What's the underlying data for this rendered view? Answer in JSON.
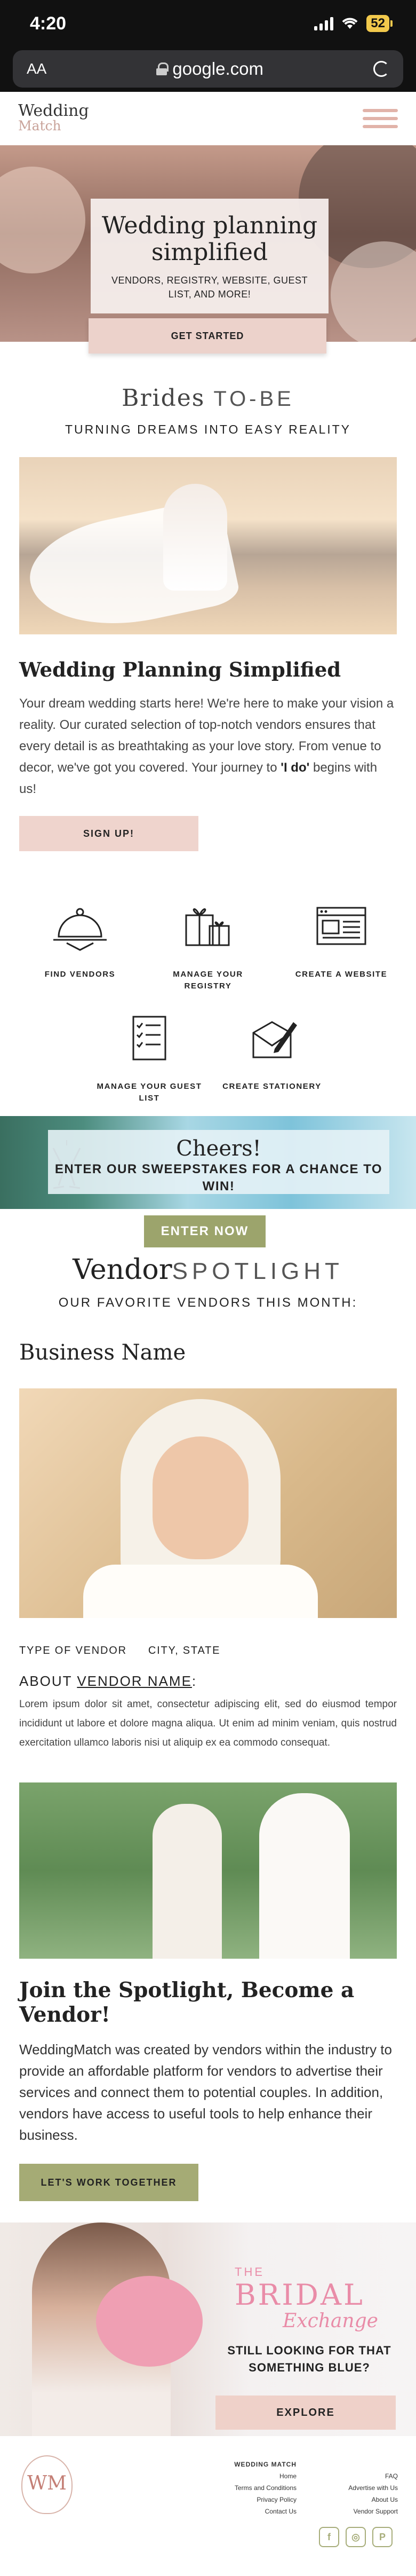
{
  "status_bar": {
    "time": "4:20",
    "battery": "52"
  },
  "browser": {
    "aa_label": "AA",
    "url": "google.com"
  },
  "header": {
    "logo_line1": "Wedding",
    "logo_line2": "Match"
  },
  "hero": {
    "title": "Wedding planning simplified",
    "subtitle": "VENDORS, REGISTRY, WEBSITE, GUEST LIST, AND MORE!",
    "cta": "GET STARTED"
  },
  "brides": {
    "title_script": "Brides",
    "title_caps": "TO-BE",
    "subtitle": "TURNING DREAMS INTO EASY REALITY"
  },
  "planning": {
    "heading": "Wedding Planning Simplified",
    "paragraph": "Your dream wedding starts here!  We're here to make your vision a reality. Our curated selection of top-notch vendors ensures that every detail is as breathtaking as your love story. From venue to decor, we've got you covered. Your journey to ",
    "emphasis": "'I do'",
    "paragraph_end": " begins with us!",
    "cta": "SIGN UP!"
  },
  "features": [
    {
      "icon": "cloche-icon",
      "label": "FIND VENDORS"
    },
    {
      "icon": "gift-icon",
      "label": "MANAGE YOUR REGISTRY"
    },
    {
      "icon": "browser-window-icon",
      "label": "CREATE A WEBSITE"
    },
    {
      "icon": "checklist-icon",
      "label": "MANAGE YOUR GUEST LIST"
    },
    {
      "icon": "envelope-pen-icon",
      "label": "CREATE STATIONERY"
    }
  ],
  "sweepstakes": {
    "title": "Cheers!",
    "subtitle": "ENTER OUR SWEEPSTAKES FOR A CHANCE TO WIN!",
    "cta": "ENTER NOW"
  },
  "spotlight": {
    "title_script": "Vendor",
    "title_caps": "SPOTLIGHT",
    "subtitle": "OUR FAVORITE VENDORS THIS MONTH:",
    "business_name": "Business Name",
    "type": "TYPE OF VENDOR",
    "location": "CITY, STATE",
    "about_prefix": "ABOUT ",
    "about_name": "VENDOR NAME",
    "about_suffix": ":",
    "description": "Lorem ipsum dolor sit amet, consectetur adipiscing elit, sed do eiusmod tempor incididunt ut labore et dolore magna aliqua. Ut enim ad minim veniam, quis nostrud exercitation ullamco laboris nisi ut aliquip ex ea commodo consequat."
  },
  "join": {
    "heading": "Join the Spotlight, Become a Vendor!",
    "paragraph": "WeddingMatch was created by vendors within the industry to provide an affordable platform for vendors to advertise their services and connect them to potential couples. In addition, vendors have access to useful tools to help enhance their business.",
    "cta": "LET'S WORK TOGETHER"
  },
  "bridal_exchange": {
    "the": "THE",
    "bridal": "BRIDAL",
    "exchange": "Exchange",
    "question": "STILL LOOKING FOR THAT SOMETHING BLUE?",
    "cta": "EXPLORE"
  },
  "footer": {
    "logo_monogram": "WM",
    "col1": {
      "heading": "WEDDING MATCH",
      "links": [
        "Home",
        "Terms and Conditions",
        "Privacy Policy",
        "Contact Us"
      ]
    },
    "col2": {
      "links": [
        "FAQ",
        "Advertise with Us",
        "About Us",
        "Vendor Support"
      ]
    },
    "socials": [
      {
        "icon": "facebook-icon",
        "glyph": "f"
      },
      {
        "icon": "instagram-icon",
        "glyph": "◎"
      },
      {
        "icon": "pinterest-icon",
        "glyph": "P"
      }
    ]
  },
  "colors": {
    "blush": "#efd4cd",
    "olive": "#a5ab75",
    "pink_text": "#e98ca8"
  }
}
